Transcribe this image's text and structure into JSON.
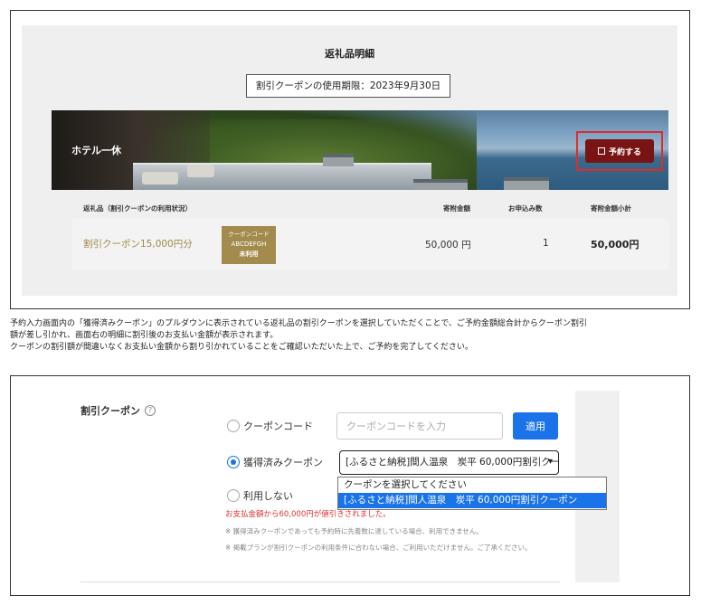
{
  "panel1": {
    "title": "返礼品明細",
    "deadline": "割引クーポンの使用期限：2023年9月30日",
    "hotel_name": "ホテル一休",
    "reserve_button": "予約する",
    "reserve_icon": "copy-icon",
    "table": {
      "headers": {
        "product": "返礼品（割引クーポンの利用状況）",
        "amount": "寄附金額",
        "quantity": "お申込み数",
        "subtotal": "寄附金額小計"
      },
      "row": {
        "product": "割引クーポン15,000円分",
        "badge_label": "クーポンコード",
        "badge_code": "ABCDEFGH",
        "badge_status": "未利用",
        "amount": "50,000 円",
        "quantity": "1",
        "subtotal": "50,000円"
      }
    },
    "colors": {
      "reserve_bg": "#7a1414",
      "highlight": "#e22b2b",
      "badge_bg": "#a38a4d",
      "product_text": "#a08848"
    }
  },
  "description": {
    "line1": "予約入力画面内の「獲得済みクーポン」のプルダウンに表示されている返礼品の割引クーポンを選択していただくことで、ご予約金額総合計からクーポン割引",
    "line2": "額が差し引かれ、画面右の明細に割引後のお支払い金額が表示されます。",
    "line3": "クーポンの割引額が間違いなくお支払い金額から割り引かれていることをご確認いただいた上で、ご予約を完了してください。"
  },
  "panel2": {
    "section_title": "割引クーポン",
    "help_icon": "question-circle-icon",
    "option_code": "クーポンコード",
    "code_placeholder": "クーポンコードを入力",
    "apply_button": "適用",
    "option_acquired": "獲得済みクーポン",
    "select_value": "[ふるさと納税]間人温泉　炭平 60,000円割引クーポン",
    "dropdown_options": [
      "クーポンを選択してください",
      "[ふるさと納税]間人温泉　炭平 60,000円割引クーポン"
    ],
    "option_none": "利用しない",
    "notice_red": "お支払金額から60,000円が値引きされました。",
    "note1": "※ 獲得済みクーポンであっても予約時に先着数に達している場合、利用できません。",
    "note2": "※ 掲載プランが割引クーポンの利用条件に合わない場合、ご利用いただけません。ご了承ください。",
    "colors": {
      "primary": "#1a73e8",
      "notice": "#e03030"
    }
  }
}
